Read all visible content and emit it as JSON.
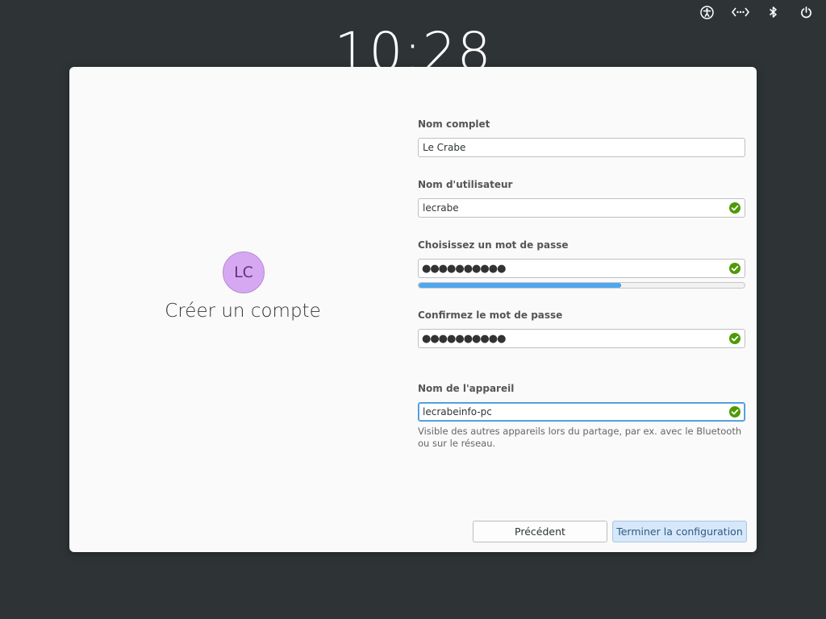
{
  "topbar": {
    "icons": [
      "accessibility-icon",
      "network-icon",
      "bluetooth-icon",
      "power-icon"
    ]
  },
  "clock": "10:28",
  "dialog": {
    "avatar_initials": "LC",
    "title": "Créer un compte",
    "fields": {
      "full_name": {
        "label": "Nom complet",
        "value": "Le Crabe"
      },
      "username": {
        "label": "Nom d'utilisateur",
        "value": "lecrabe"
      },
      "password": {
        "label": "Choisissez un mot de passe",
        "value": "●●●●●●●●●●",
        "strength": 0.62
      },
      "confirm": {
        "label": "Confirmez le mot de passe",
        "value": "●●●●●●●●●●"
      },
      "device": {
        "label": "Nom de l'appareil",
        "value": "lecrabeinfo-pc",
        "hint": "Visible des autres appareils lors du partage, par ex. avec le Bluetooth ou sur le réseau."
      }
    },
    "buttons": {
      "previous": "Précédent",
      "finish": "Terminer la configuration"
    }
  },
  "colors": {
    "background": "#2e3436",
    "dialog": "#fafafa",
    "check": "#4e9a06",
    "accent": "#4fa7ef"
  }
}
